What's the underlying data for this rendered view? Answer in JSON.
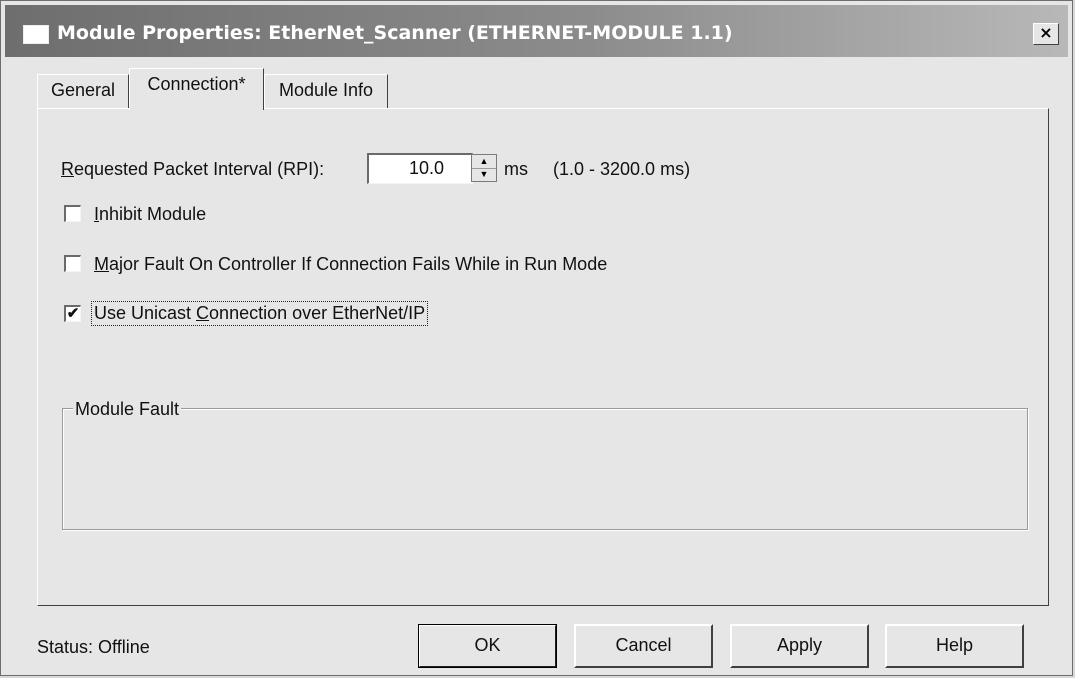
{
  "window": {
    "title": "Module Properties: EtherNet_Scanner (ETHERNET-MODULE 1.1)",
    "close_glyph": "×"
  },
  "tabs": [
    {
      "label": "General"
    },
    {
      "label": "Connection*",
      "selected": true
    },
    {
      "label": "Module Info"
    }
  ],
  "connection": {
    "rpi_label_key": "R",
    "rpi_label_rest": "equested Packet Interval (RPI):",
    "rpi_value": "10.0",
    "rpi_unit": "ms",
    "rpi_range": "(1.0 - 3200.0 ms)",
    "inhibit": {
      "key": "I",
      "rest": "nhibit Module",
      "checked": false
    },
    "major_fault": {
      "key": "M",
      "rest": "ajor Fault On Controller If Connection Fails While in Run Mode",
      "checked": false
    },
    "unicast": {
      "before": "Use Unicast ",
      "key": "C",
      "rest": "onnection over EtherNet/IP",
      "checked": true,
      "check_glyph": "✔"
    },
    "module_fault_label": "Module Fault"
  },
  "status": {
    "text": "Status:  Offline"
  },
  "buttons": {
    "ok": "OK",
    "cancel": "Cancel",
    "apply": "Apply",
    "help": "Help"
  },
  "icons": {
    "spin_up": "▲",
    "spin_down": "▼"
  }
}
